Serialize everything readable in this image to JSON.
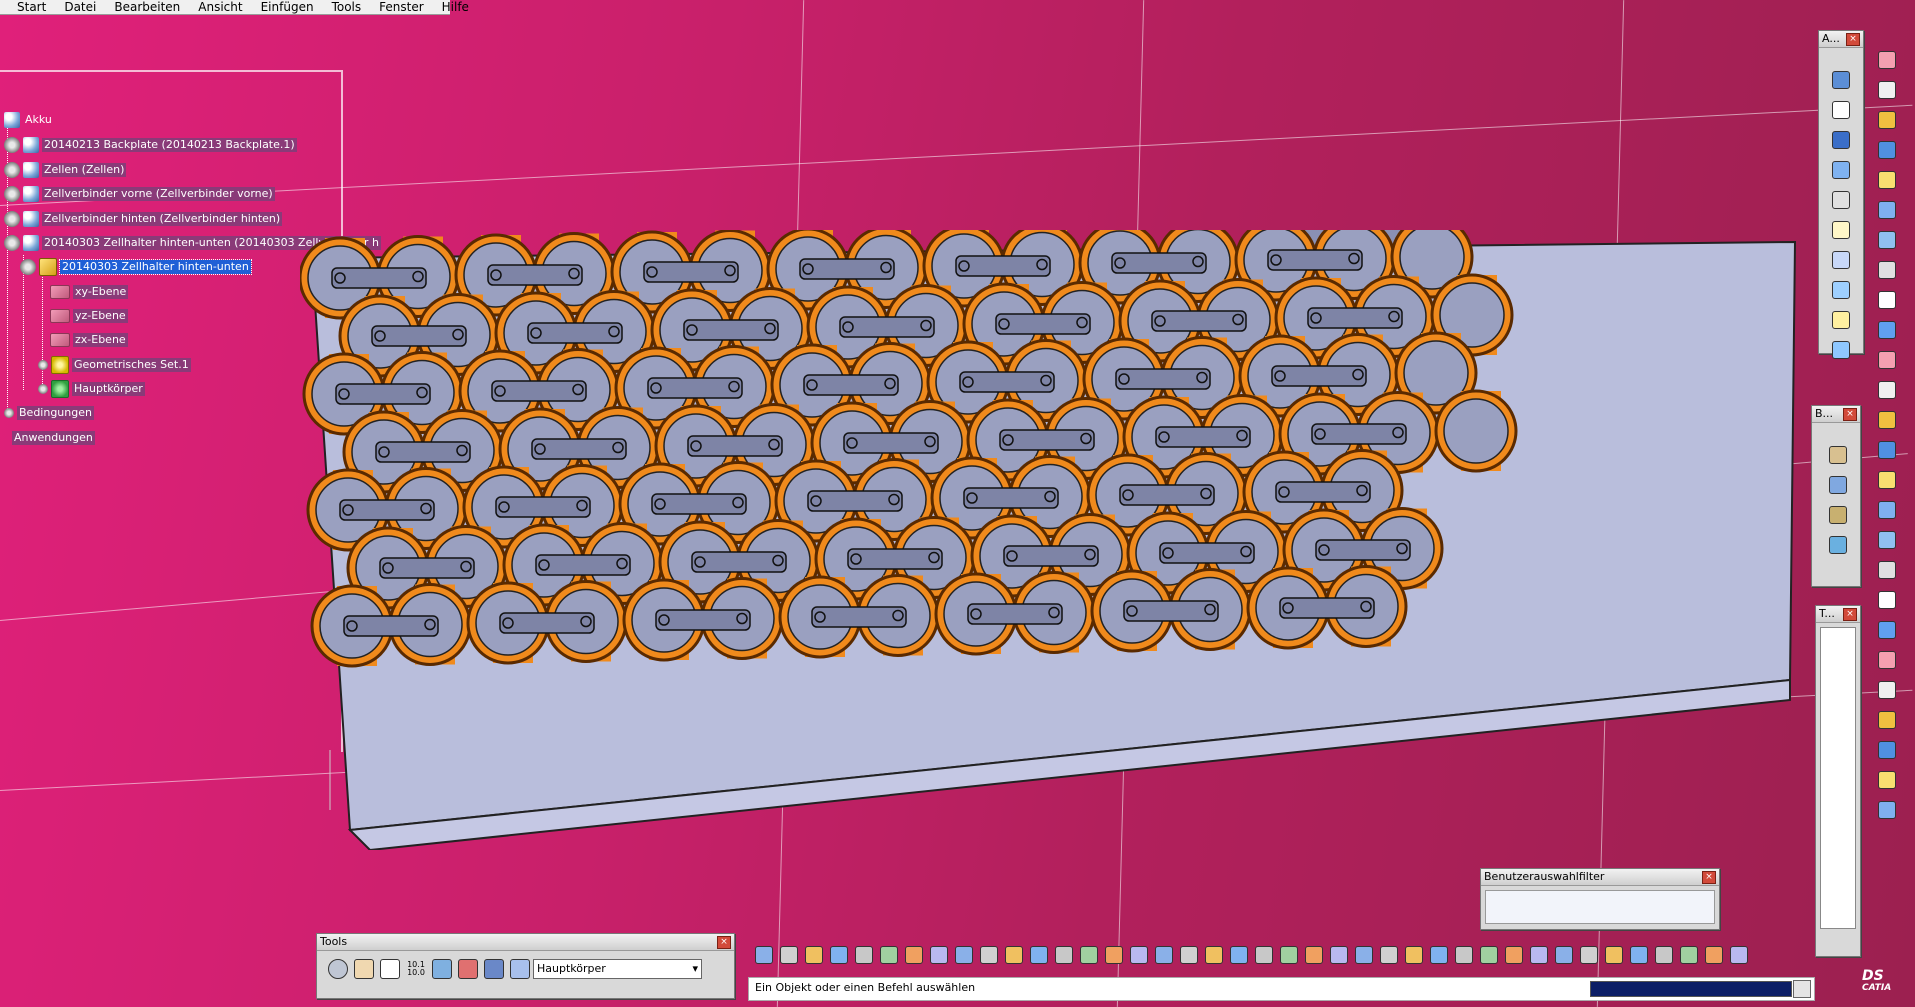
{
  "menu": {
    "items": [
      "Start",
      "Datei",
      "Bearbeiten",
      "Ansicht",
      "Einfügen",
      "Tools",
      "Fenster",
      "Hilfe"
    ]
  },
  "tree": {
    "root": "Akku",
    "nodes": [
      {
        "label": "20140213 Backplate (20140213 Backplate.1)"
      },
      {
        "label": "Zellen (Zellen)"
      },
      {
        "label": "Zellverbinder vorne (Zellverbinder vorne)"
      },
      {
        "label": "Zellverbinder hinten (Zellverbinder hinten)"
      },
      {
        "label": "20140303 Zellhalter hinten-unten (20140303 Zellverhalter h"
      }
    ],
    "part": "20140303 Zellhalter hinten-unten",
    "children": [
      {
        "label": "xy-Ebene"
      },
      {
        "label": "yz-Ebene"
      },
      {
        "label": "zx-Ebene"
      },
      {
        "label": "Geometrisches Set.1"
      },
      {
        "label": "Hauptkörper"
      }
    ],
    "constraints": "Bedingungen",
    "applications": "Anwendungen"
  },
  "toolbars": {
    "tools": {
      "title": "Tools",
      "body_select": "Hauptkörper",
      "label_10": "10.1\n10.0"
    },
    "filter": {
      "title": "Benutzerauswahlfilter"
    },
    "top_right": {
      "title": "A..."
    },
    "mid_right": {
      "title": "B..."
    },
    "low_right": {
      "title": "T..."
    }
  },
  "status": {
    "message": "Ein Objekt oder einen Befehl auswählen"
  },
  "logo": {
    "brand": "DS",
    "product": "CATIA"
  },
  "colors": {
    "battery_orange": "#f08a1c",
    "holder_gray": "#9aa0c0",
    "background_magenta": "#c8206a",
    "selection_blue": "#1f5fd6"
  }
}
